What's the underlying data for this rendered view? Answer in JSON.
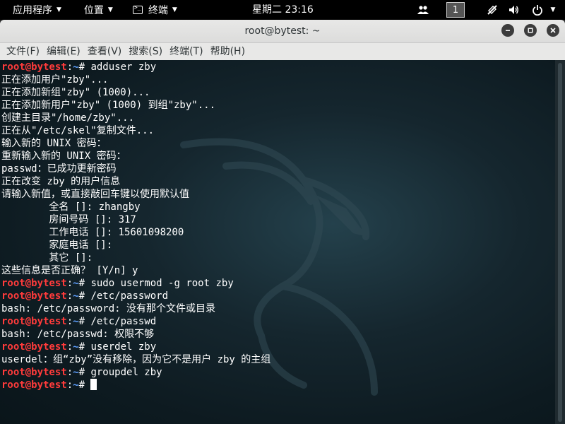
{
  "topbar": {
    "apps": "应用程序",
    "places": "位置",
    "terminal": "终端",
    "clock": "星期二 23:16",
    "workspace": "1"
  },
  "window": {
    "title": "root@bytest: ~"
  },
  "menu": [
    "文件(F)",
    "编辑(E)",
    "查看(V)",
    "搜索(S)",
    "终端(T)",
    "帮助(H)"
  ],
  "prompt": {
    "user": "root@bytest",
    "colon": ":",
    "path": "~",
    "sym": "# "
  },
  "terminal_lines": [
    {
      "type": "cmd",
      "text": "adduser zby"
    },
    {
      "type": "out",
      "text": "正在添加用户\"zby\"..."
    },
    {
      "type": "out",
      "text": "正在添加新组\"zby\" (1000)..."
    },
    {
      "type": "out",
      "text": "正在添加新用户\"zby\" (1000) 到组\"zby\"..."
    },
    {
      "type": "out",
      "text": "创建主目录\"/home/zby\"..."
    },
    {
      "type": "out",
      "text": "正在从\"/etc/skel\"复制文件..."
    },
    {
      "type": "out",
      "text": "输入新的 UNIX 密码："
    },
    {
      "type": "out",
      "text": "重新输入新的 UNIX 密码："
    },
    {
      "type": "out",
      "text": "passwd：已成功更新密码"
    },
    {
      "type": "out",
      "text": "正在改变 zby 的用户信息"
    },
    {
      "type": "out",
      "text": "请输入新值，或直接敲回车键以使用默认值"
    },
    {
      "type": "out",
      "text": "        全名 []: zhangby"
    },
    {
      "type": "out",
      "text": "        房间号码 []: 317"
    },
    {
      "type": "out",
      "text": "        工作电话 []: 15601098200"
    },
    {
      "type": "out",
      "text": "        家庭电话 []:"
    },
    {
      "type": "out",
      "text": "        其它 []:"
    },
    {
      "type": "out",
      "text": "这些信息是否正确？ [Y/n] y"
    },
    {
      "type": "cmd",
      "text": "sudo usermod -g root zby"
    },
    {
      "type": "cmd",
      "text": "/etc/password"
    },
    {
      "type": "out",
      "text": "bash: /etc/password: 没有那个文件或目录"
    },
    {
      "type": "cmd",
      "text": "/etc/passwd"
    },
    {
      "type": "out",
      "text": "bash: /etc/passwd: 权限不够"
    },
    {
      "type": "cmd",
      "text": "userdel zby"
    },
    {
      "type": "out",
      "text": "userdel：组“zby”没有移除，因为它不是用户 zby 的主组"
    },
    {
      "type": "cmd",
      "text": "groupdel zby"
    },
    {
      "type": "cmd",
      "text": ""
    }
  ],
  "icons": {
    "terminal_app": "terminal-icon",
    "caret": "chevron-down-icon",
    "people": "people-icon",
    "network": "network-off-icon",
    "volume": "volume-icon",
    "power": "power-icon",
    "minimize": "minimize-icon",
    "maximize": "maximize-icon",
    "close": "close-icon"
  }
}
